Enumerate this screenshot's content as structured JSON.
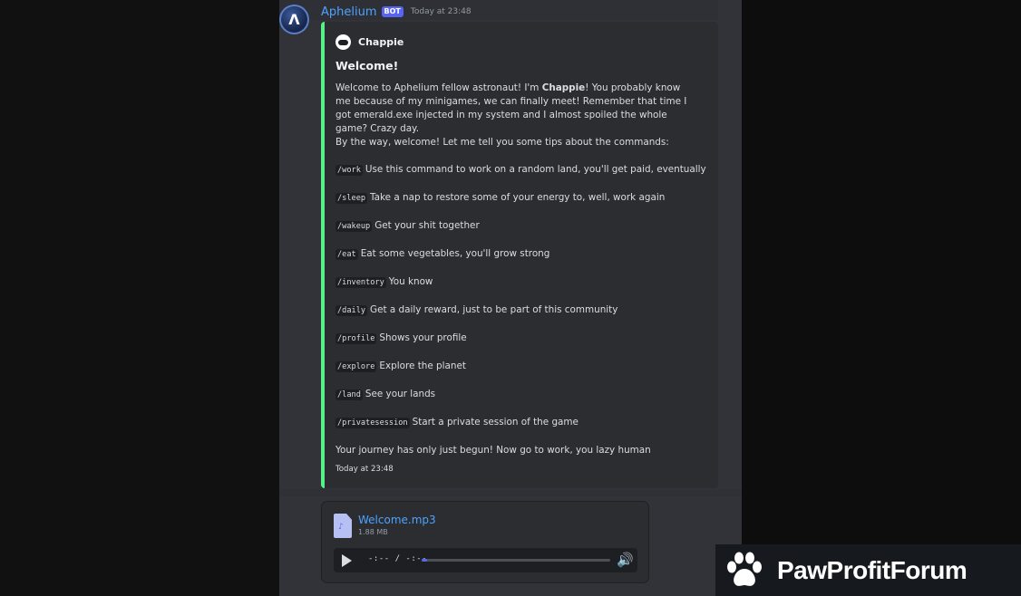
{
  "message": {
    "author": "Aphelium",
    "bot_badge": "BOT",
    "timestamp": "Today at 23:48",
    "avatar_glyph": "Λ"
  },
  "embed": {
    "accent_color": "#57f287",
    "author_name": "Chappie",
    "title": "Welcome!",
    "intro_1": "Welcome to Aphelium fellow astronaut! I'm ",
    "intro_bold": "Chappie",
    "intro_2": "! You probably know me because of my minigames, we can finally meet! Remember that time I got emerald.exe injected in my system and I almost spoiled the whole game? Crazy day.",
    "intro_3": "By the way, welcome! Let me tell you some tips about the commands:",
    "commands": [
      {
        "cmd": "/work",
        "desc": "Use this command to work on a random land, you'll get paid, eventually"
      },
      {
        "cmd": "/sleep",
        "desc": "Take a nap to restore some of your energy to, well, work again"
      },
      {
        "cmd": "/wakeup",
        "desc": "Get your shit together"
      },
      {
        "cmd": "/eat",
        "desc": "Eat some vegetables, you'll grow strong"
      },
      {
        "cmd": "/inventory",
        "desc": "You know"
      },
      {
        "cmd": "/daily",
        "desc": "Get a daily reward, just to be part of this community"
      },
      {
        "cmd": "/profile",
        "desc": "Shows your profile"
      },
      {
        "cmd": "/explore",
        "desc": "Explore the planet"
      },
      {
        "cmd": "/land",
        "desc": "See your lands"
      },
      {
        "cmd": "/privatesession",
        "desc": "Start a private session of the game"
      }
    ],
    "closing": "Your journey has only just begun! Now go to work, you lazy human",
    "footer": "Today at 23:48"
  },
  "attachment": {
    "file_name": "Welcome.mp3",
    "file_size": "1.88 MB",
    "time_readout": "-:-- / -:--",
    "progress": 0.03
  },
  "watermark": {
    "text": "PawProfitForum"
  },
  "icons": [
    "avatar",
    "astronaut-icon",
    "audio-file-icon",
    "play-icon",
    "volume-icon",
    "paw-icon"
  ]
}
